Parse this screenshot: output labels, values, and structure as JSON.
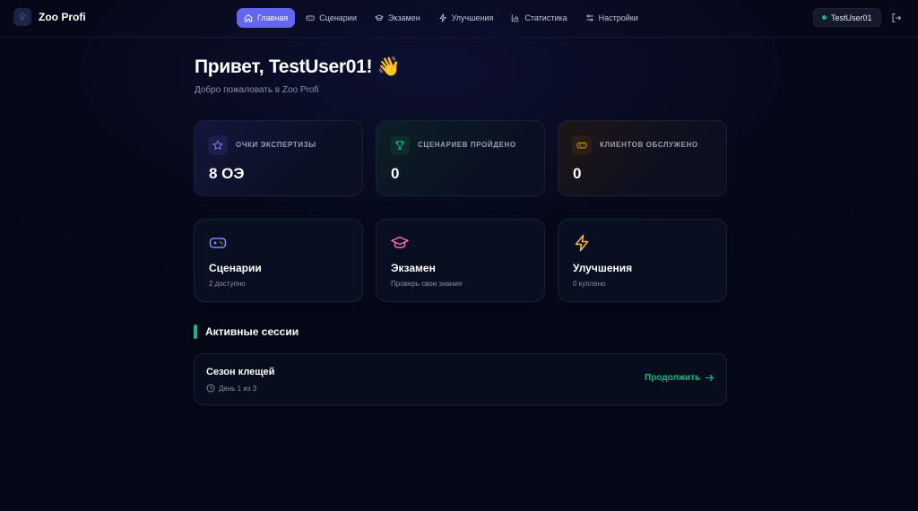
{
  "app": {
    "name": "Zoo Profi"
  },
  "nav": {
    "items": [
      {
        "label": "Главная",
        "icon": "home-icon",
        "active": true
      },
      {
        "label": "Сценарии",
        "icon": "gamepad-icon",
        "active": false
      },
      {
        "label": "Экзамен",
        "icon": "graduation-cap-icon",
        "active": false
      },
      {
        "label": "Улучшения",
        "icon": "lightning-icon",
        "active": false
      },
      {
        "label": "Статистика",
        "icon": "bar-chart-icon",
        "active": false
      },
      {
        "label": "Настройки",
        "icon": "sliders-icon",
        "active": false
      }
    ],
    "user": "TestUser01"
  },
  "greeting": {
    "title": "Привет, TestUser01! 👋",
    "subtitle": "Добро пожаловать в Zoo Profi"
  },
  "stats": [
    {
      "label": "ОЧКИ ЭКСПЕРТИЗЫ",
      "value": "8 ОЭ",
      "icon": "star-icon",
      "color": "#818cf8"
    },
    {
      "label": "СЦЕНАРИЕВ ПРОЙДЕНО",
      "value": "0",
      "icon": "trophy-icon",
      "color": "#10b981"
    },
    {
      "label": "КЛИЕНТОВ ОБСЛУЖЕНО",
      "value": "0",
      "icon": "gamepad-icon",
      "color": "#f59e0b"
    }
  ],
  "cards": [
    {
      "title": "Сценарии",
      "subtitle": "2 доступно",
      "icon": "gamepad-icon",
      "color": "#818cf8"
    },
    {
      "title": "Экзамен",
      "subtitle": "Проверь свои знания",
      "icon": "graduation-cap-icon",
      "color": "#f472b6"
    },
    {
      "title": "Улучшения",
      "subtitle": "0 куплено",
      "icon": "lightning-icon",
      "color": "#fbbf24"
    }
  ],
  "sessions": {
    "title": "Активные сессии",
    "items": [
      {
        "name": "Сезон клещей",
        "meta": "День 1 из 3",
        "action": "Продолжить"
      }
    ]
  },
  "colors": {
    "accent": "#6366f1",
    "success": "#10b981",
    "background": "#060819"
  }
}
